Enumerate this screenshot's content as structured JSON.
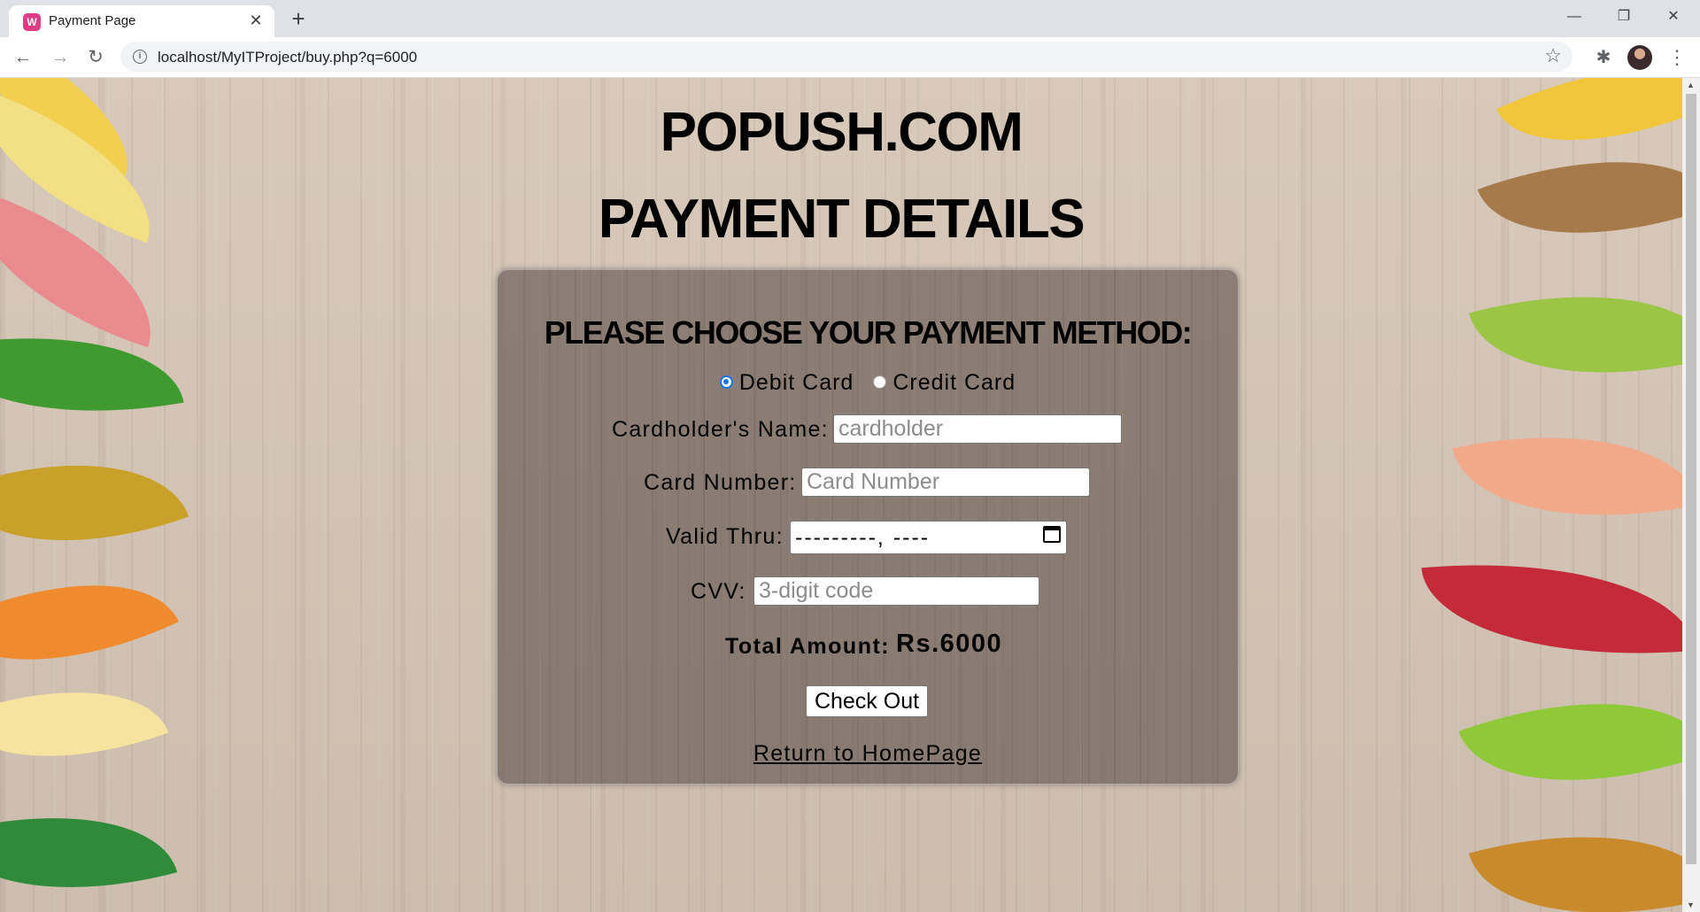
{
  "browser": {
    "tab_title": "Payment Page",
    "favicon_letter": "W",
    "url": "localhost/MyITProject/buy.php?q=6000"
  },
  "icons": {
    "back": "back-arrow-icon",
    "forward": "forward-arrow-icon",
    "reload": "reload-icon",
    "info": "info-icon",
    "star": "bookmark-star-icon",
    "extensions": "puzzle-icon",
    "menu": "kebab-menu-icon"
  },
  "page": {
    "site_title": "POPUSH.COM",
    "page_title": "PAYMENT DETAILS",
    "method_heading": "PLEASE CHOOSE YOUR PAYMENT METHOD:",
    "payment_methods": [
      {
        "label": "Debit Card",
        "checked": true
      },
      {
        "label": "Credit Card",
        "checked": false
      }
    ],
    "fields": {
      "cardholder": {
        "label": "Cardholder's Name:",
        "placeholder": "cardholder"
      },
      "card_number": {
        "label": "Card Number:",
        "placeholder": "Card Number"
      },
      "valid_thru": {
        "label": "Valid Thru:",
        "display": "---------, ----"
      },
      "cvv": {
        "label": "CVV:",
        "placeholder": "3-digit code"
      }
    },
    "total_label": "Total Amount:",
    "total_value": "Rs.6000",
    "checkout_label": "Check Out",
    "home_link": "Return to HomePage"
  },
  "colors": {
    "radio_accent": "#1a73e8",
    "favicon": "#e03b86"
  }
}
